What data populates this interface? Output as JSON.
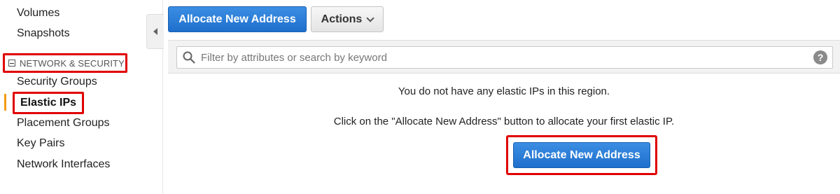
{
  "sidebar": {
    "items_top": [
      {
        "label": "Volumes"
      },
      {
        "label": "Snapshots"
      }
    ],
    "section": {
      "label": "NETWORK & SECURITY"
    },
    "items": [
      {
        "label": "Security Groups"
      },
      {
        "label": "Elastic IPs",
        "active": true
      },
      {
        "label": "Placement Groups"
      },
      {
        "label": "Key Pairs"
      },
      {
        "label": "Network Interfaces"
      }
    ]
  },
  "toolbar": {
    "allocate_label": "Allocate New Address",
    "actions_label": "Actions"
  },
  "filter": {
    "placeholder": "Filter by attributes or search by keyword",
    "value": "",
    "help": "?"
  },
  "empty_state": {
    "line1": "You do not have any elastic IPs in this region.",
    "line2": "Click on the \"Allocate New Address\" button to allocate your first elastic IP.",
    "button_label": "Allocate New Address"
  },
  "colors": {
    "primary": "#1f6fcc",
    "highlight": "#e00000",
    "active_indicator": "#f39c12"
  }
}
